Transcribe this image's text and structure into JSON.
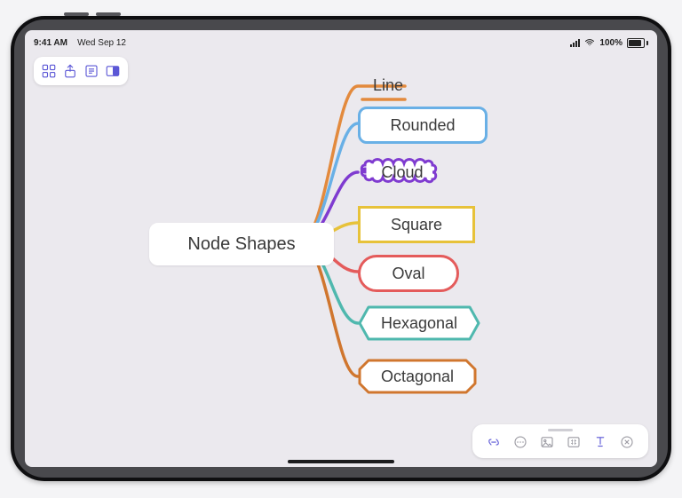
{
  "status": {
    "time": "9:41 AM",
    "date": "Wed Sep 12",
    "battery": "100%"
  },
  "root": {
    "label": "Node Shapes"
  },
  "nodes": {
    "line": {
      "label": "Line",
      "color": "#e38a3d"
    },
    "rounded": {
      "label": "Rounded",
      "color": "#69b0e6"
    },
    "cloud": {
      "label": "Cloud",
      "color": "#7f3bd0"
    },
    "square": {
      "label": "Square",
      "color": "#e7c23a"
    },
    "oval": {
      "label": "Oval",
      "color": "#e45b5b"
    },
    "hexagonal": {
      "label": "Hexagonal",
      "color": "#4fb8ae"
    },
    "octagonal": {
      "label": "Octagonal",
      "color": "#d0762e"
    }
  },
  "toolbar": {
    "grid": "app-grid-icon",
    "share": "share-icon",
    "list": "outline-icon",
    "panel": "panel-toggle-icon"
  },
  "bottom_toolbar": {
    "link": "link-icon",
    "more": "more-icon",
    "image": "image-icon",
    "tag": "tag-icon",
    "style": "style-icon",
    "delete": "delete-icon"
  }
}
